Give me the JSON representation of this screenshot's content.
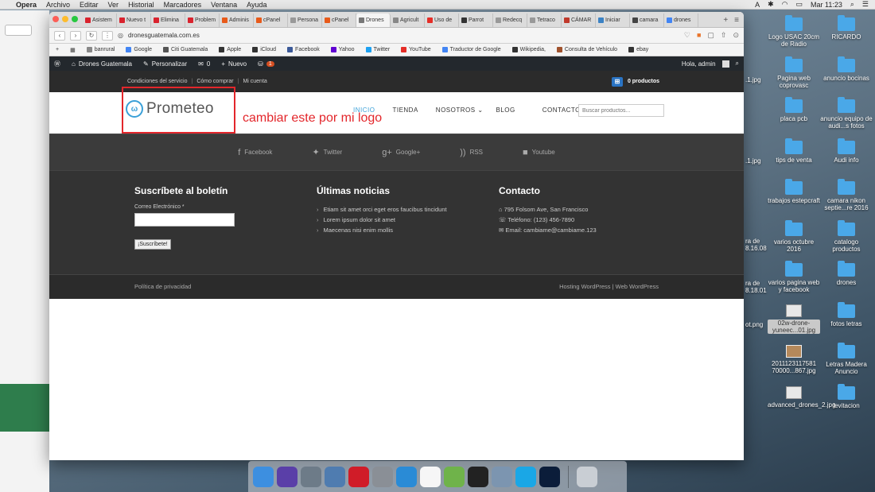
{
  "menubar": {
    "app": "Opera",
    "items": [
      "Archivo",
      "Editar",
      "Ver",
      "Historial",
      "Marcadores",
      "Ventana",
      "Ayuda"
    ],
    "clock": "Mar 11:23"
  },
  "tabs": [
    {
      "label": "Asistem",
      "color": "#d9232e"
    },
    {
      "label": "Nuevo t",
      "color": "#d9232e"
    },
    {
      "label": "Elimina",
      "color": "#d9232e"
    },
    {
      "label": "Problem",
      "color": "#d9232e"
    },
    {
      "label": "Adminis",
      "color": "#e85a1a"
    },
    {
      "label": "cPanel",
      "color": "#e85a1a"
    },
    {
      "label": "Persona",
      "color": "#999999"
    },
    {
      "label": "cPanel",
      "color": "#e85a1a"
    },
    {
      "label": "Drones",
      "color": "#777777",
      "active": true
    },
    {
      "label": "Agricult",
      "color": "#888888"
    },
    {
      "label": "Uso de",
      "color": "#e52d27"
    },
    {
      "label": "Parrot",
      "color": "#333333"
    },
    {
      "label": "Redecq",
      "color": "#999999"
    },
    {
      "label": "Tetraco",
      "color": "#999999"
    },
    {
      "label": "CÁMAR",
      "color": "#c0392b"
    },
    {
      "label": "Iniciar",
      "color": "#3b82c4"
    },
    {
      "label": "camara",
      "color": "#444444"
    },
    {
      "label": "drones",
      "color": "#4285f4"
    }
  ],
  "address": {
    "url": "dronesguatemala.com.es"
  },
  "bookmarks": [
    {
      "label": "banrural",
      "color": "#888888"
    },
    {
      "label": "Google",
      "color": "#4285f4"
    },
    {
      "label": "Citi Guatemala",
      "color": "#555555"
    },
    {
      "label": "Apple",
      "color": "#333333"
    },
    {
      "label": "iCloud",
      "color": "#333333"
    },
    {
      "label": "Facebook",
      "color": "#3b5998"
    },
    {
      "label": "Yahoo",
      "color": "#6001d2"
    },
    {
      "label": "Twitter",
      "color": "#1da1f2"
    },
    {
      "label": "YouTube",
      "color": "#e52d27"
    },
    {
      "label": "Traductor de Google",
      "color": "#4285f4"
    },
    {
      "label": "Wikipedia,",
      "color": "#333333"
    },
    {
      "label": "Consulta de Vehículo",
      "color": "#a0522d"
    },
    {
      "label": "ebay",
      "color": "#333333"
    }
  ],
  "wpbar": {
    "site": "Drones Guatemala",
    "customize": "Personalizar",
    "comments": "0",
    "new": "Nuevo",
    "updates": "1",
    "greeting": "Hola, admin"
  },
  "util": {
    "links": [
      "Condiciones del servicio",
      "Cómo comprar",
      "Mi cuenta"
    ],
    "cart": "0 productos"
  },
  "header": {
    "logo_name": "Prometeo",
    "annotation": "cambiar este por mi logo",
    "nav": [
      "INICIO",
      "TIENDA",
      "NOSOTROS",
      "BLOG",
      "CONTACTO"
    ],
    "search_placeholder": "Buscar productos..."
  },
  "social": [
    "Facebook",
    "Twitter",
    "Google+",
    "RSS",
    "Youtube"
  ],
  "footer": {
    "newsletter_title": "Suscríbete al boletín",
    "email_label": "Correo Electrónico *",
    "subscribe_label": "¡Suscríbete!",
    "news_title": "Últimas noticias",
    "news": [
      "Etiam sit amet orci eget eros faucibus tincidunt",
      "Lorem ipsum dolor sit amet",
      "Maecenas nisi enim mollis"
    ],
    "contact_title": "Contacto",
    "contact": [
      "795 Folsom Ave, San Francisco",
      "Teléfono: (123) 456-7890",
      "Email: cambiame@cambiame.123"
    ],
    "privacy": "Política de privacidad",
    "credit1": "Hosting WordPress",
    "credit2": "Web WordPress"
  },
  "desktop": [
    {
      "label": "Logo USAC 20cm de Radio",
      "kind": "folder"
    },
    {
      "label": "RICARDO",
      "kind": "folder"
    },
    {
      "label": "Pagina web coprovasc",
      "kind": "folder"
    },
    {
      "label": "anuncio bocinas",
      "kind": "folder"
    },
    {
      "label": "placa pcb",
      "kind": "folder"
    },
    {
      "label": "anuncio equipo de audi...s fotos",
      "kind": "folder"
    },
    {
      "label": "tips de venta",
      "kind": "folder"
    },
    {
      "label": "Audi info",
      "kind": "folder"
    },
    {
      "label": "trabajos estepcraft",
      "kind": "folder"
    },
    {
      "label": "camara nikon septie...re 2016",
      "kind": "folder"
    },
    {
      "label": "varios octubre 2016",
      "kind": "folder"
    },
    {
      "label": "catalogo productos",
      "kind": "folder"
    },
    {
      "label": "varios pagina web y facebook",
      "kind": "folder"
    },
    {
      "label": "drones",
      "kind": "folder"
    },
    {
      "label": "02w-drone-yuneec...01.jpg",
      "kind": "thumb"
    },
    {
      "label": "fotos letras",
      "kind": "folder"
    },
    {
      "label": "2011123117581 70000...867.jpg",
      "kind": "img"
    },
    {
      "label": "Letras Madera Anuncio",
      "kind": "folder"
    },
    {
      "label": "advanced_drones_2.jpg",
      "kind": "thumb"
    },
    {
      "label": "levitacion",
      "kind": "folder"
    }
  ],
  "edge_labels": [
    ".1.jpg",
    ".1.jpg",
    "ra de 8.16.08",
    "ra de 8.18.01",
    "ot.png"
  ],
  "dock": [
    {
      "name": "finder",
      "color": "#3d8fe0"
    },
    {
      "name": "siri",
      "color": "#5a3fa8"
    },
    {
      "name": "launchpad",
      "color": "#6d7b88"
    },
    {
      "name": "mail-bird",
      "color": "#4f7cb0"
    },
    {
      "name": "opera",
      "color": "#d01c28"
    },
    {
      "name": "system-preferences",
      "color": "#8a8f96"
    },
    {
      "name": "word-w",
      "color": "#2a8bd6"
    },
    {
      "name": "calendar",
      "color": "#f6f6f6"
    },
    {
      "name": "fork",
      "color": "#6fb34a"
    },
    {
      "name": "activity",
      "color": "#222222"
    },
    {
      "name": "preview",
      "color": "#7c95b0"
    },
    {
      "name": "skype",
      "color": "#1aa7e6"
    },
    {
      "name": "photoshop",
      "color": "#0b1d3a"
    },
    {
      "name": "trash",
      "color": "#c9ced4"
    }
  ]
}
